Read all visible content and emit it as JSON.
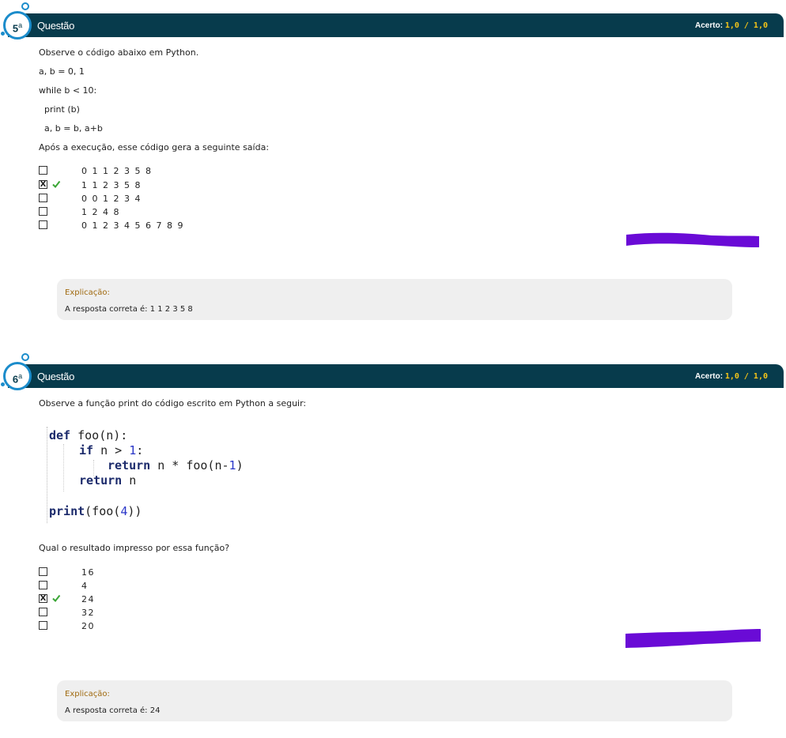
{
  "q5": {
    "number": "5",
    "ordinal": "a",
    "title": "Questão",
    "score_label": "Acerto:",
    "score_value": "1,0  / 1,0",
    "statement": "Observe o código abaixo em Python.",
    "code": [
      "a, b = 0, 1",
      "while b < 10:",
      "  print (b)",
      "  a, b = b, a+b"
    ],
    "prompt": "Após a execução, esse código gera a seguinte saída:",
    "options": [
      {
        "text": "0 1 1 2 3 5 8",
        "marked": "",
        "correct": false
      },
      {
        "text": "1 1 2 3 5 8",
        "marked": "X",
        "correct": true
      },
      {
        "text": "0 0 1 2 3 4",
        "marked": "",
        "correct": false
      },
      {
        "text": "1 2 4 8",
        "marked": "",
        "correct": false
      },
      {
        "text": "0 1 2 3 4 5 6 7 8 9",
        "marked": "",
        "correct": false
      }
    ],
    "explanation_label": "Explicação:",
    "explanation_text": "A resposta correta é: 1 1 2 3 5 8"
  },
  "q6": {
    "number": "6",
    "ordinal": "a",
    "title": "Questão",
    "score_label": "Acerto:",
    "score_value": "1,0  / 1,0",
    "statement": "Observe a função print do código escrito em Python a seguir:",
    "code": {
      "l1_kw": "def",
      "l1_rest": " foo(n):",
      "l2_kw": "if",
      "l2_a": " n > ",
      "l2_num": "1",
      "l2_b": ":",
      "l3_kw": "return",
      "l3_a": " n * foo(n-",
      "l3_num": "1",
      "l3_b": ")",
      "l4_kw": "return",
      "l4_rest": " n",
      "l5_kw": "print",
      "l5_a": "(foo(",
      "l5_num": "4",
      "l5_b": "))"
    },
    "prompt": "Qual o resultado impresso por essa função?",
    "options": [
      {
        "text": "16",
        "marked": "",
        "correct": false
      },
      {
        "text": "4",
        "marked": "",
        "correct": false
      },
      {
        "text": "24",
        "marked": "X",
        "correct": true
      },
      {
        "text": "32",
        "marked": "",
        "correct": false
      },
      {
        "text": "20",
        "marked": "",
        "correct": false
      }
    ],
    "explanation_label": "Explicação:",
    "explanation_text": "A resposta correta é: 24"
  },
  "colors": {
    "header_bg": "#073b4c",
    "badge_ring": "#1b8ccb",
    "score_value": "#f5c518",
    "explanation_label": "#a06a10",
    "check": "#3aa636",
    "redaction": "#6a0bd6"
  }
}
